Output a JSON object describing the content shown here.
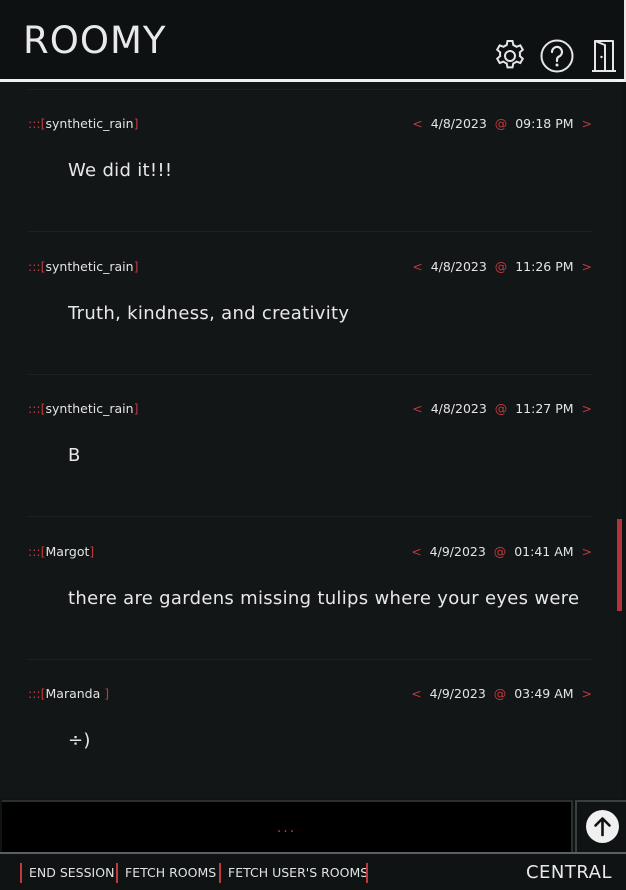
{
  "app": {
    "title": "ROOMY"
  },
  "header": {
    "icons": [
      "gear-icon",
      "help-icon",
      "door-exit-icon"
    ]
  },
  "messages": [
    {
      "deco": ":::[",
      "author": "synthetic_rain",
      "close": "]",
      "date": "4/8/2023",
      "at": "@",
      "time": "09:18 PM",
      "text": "We did it!!!"
    },
    {
      "deco": ":::[",
      "author": "synthetic_rain",
      "close": "]",
      "date": "4/8/2023",
      "at": "@",
      "time": "11:26 PM",
      "text": "Truth, kindness, and creativity"
    },
    {
      "deco": ":::[",
      "author": "synthetic_rain",
      "close": "]",
      "date": "4/8/2023",
      "at": "@",
      "time": "11:27 PM",
      "text": "B"
    },
    {
      "deco": ":::[",
      "author": "Margot",
      "close": "]",
      "date": "4/9/2023",
      "at": "@",
      "time": "01:41 AM",
      "text": "there are gardens missing tulips where your eyes were"
    },
    {
      "deco": ":::[",
      "author": "Maranda ",
      "close": "]",
      "date": "4/9/2023",
      "at": "@",
      "time": "03:49 AM",
      "text": "÷)"
    }
  ],
  "composer": {
    "typing_indicator": "..."
  },
  "send": {
    "icon": "arrow-up-icon"
  },
  "footer": {
    "end_session": "END SESSION",
    "fetch_rooms": "FETCH ROOMS",
    "fetch_user_rooms": "FETCH USER'S ROOMS",
    "room": "CENTRAL"
  },
  "colors": {
    "accent": "#c2393d",
    "background": "#121617",
    "text": "#e6e6e6"
  }
}
